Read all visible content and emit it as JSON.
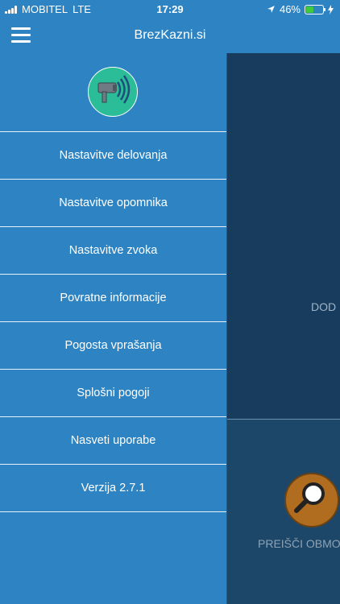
{
  "status_bar": {
    "carrier": "MOBITEL",
    "network": "LTE",
    "time": "17:29",
    "battery": "46%",
    "icons": [
      "signal-icon",
      "location-arrow-icon",
      "battery-icon",
      "charging-icon"
    ]
  },
  "header": {
    "title": "BrezKazni.si",
    "menu_icon": "hamburger-icon"
  },
  "menu": {
    "logo_icon": "speed-camera-icon",
    "items": [
      {
        "label": "Nastavitve delovanja"
      },
      {
        "label": "Nastavitve opomnika"
      },
      {
        "label": "Nastavitve zvoka"
      },
      {
        "label": "Povratne informacije"
      },
      {
        "label": "Pogosta vprašanja"
      },
      {
        "label": "Splošni pogoji"
      },
      {
        "label": "Nasveti uporabe"
      },
      {
        "label": "Verzija 2.7.1"
      }
    ]
  },
  "main": {
    "top_button_label": "DOD",
    "bottom_button_label": "PREIŠČI OBMO",
    "bottom_icon": "magnifier-icon"
  },
  "colors": {
    "menu_bg": "#2e84c2",
    "logo_bg": "#2bbd97",
    "main_dark": "#173c5d",
    "search_circle": "#b06d1f",
    "battery_fill": "#3ec93e"
  }
}
